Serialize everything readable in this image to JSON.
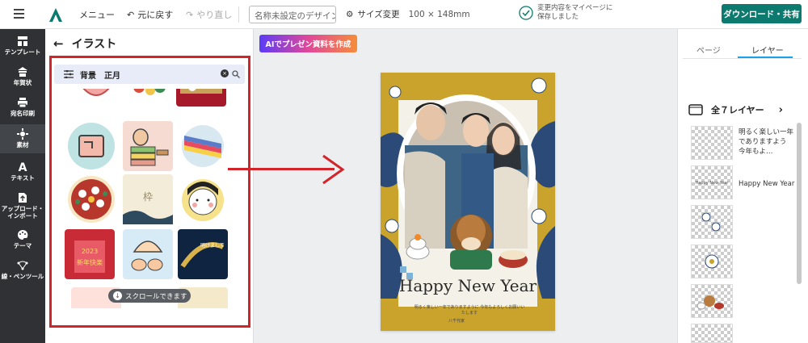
{
  "topbar": {
    "menu_label": "メニュー",
    "undo_label": "元に戻す",
    "redo_label": "やり直し",
    "design_name_placeholder": "名称未設定のデザイン",
    "resize_label": "サイズ変更",
    "size_value": "100 × 148mm",
    "saved_status": "変更内容をマイページに保存しました",
    "download_label": "ダウンロード・共有",
    "brand_color": "#0c7a6e"
  },
  "leftnav": {
    "items": [
      {
        "label": "テンプレート",
        "icon": "template-icon"
      },
      {
        "label": "年賀状",
        "icon": "newyear-card-icon"
      },
      {
        "label": "宛名印刷",
        "icon": "printer-icon"
      },
      {
        "label": "素材",
        "icon": "material-icon",
        "active": true
      },
      {
        "label": "テキスト",
        "icon": "text-icon"
      },
      {
        "label": "アップロード・インポート",
        "icon": "upload-icon"
      },
      {
        "label": "テーマ",
        "icon": "palette-icon"
      },
      {
        "label": "線・ペンツール",
        "icon": "pen-tool-icon"
      }
    ]
  },
  "panel": {
    "title": "イラスト",
    "search_value": "背景　正月",
    "scroll_hint": "スクロールできます",
    "highlight_color": "#d3242a"
  },
  "canvas": {
    "ai_button": "AIでプレゼン資料を作成",
    "card": {
      "greeting": "Happy New Year",
      "message": "明るく楽しい一年でありますように 今年もよろしくお願いいたします",
      "name": "八千代家"
    }
  },
  "rightpanel": {
    "tabs": [
      "ページ",
      "レイヤー"
    ],
    "active_tab": "レイヤー",
    "layer_count_label": "全７レイヤー",
    "layers": [
      {
        "label": "明るく楽しい一年でありますよう 今年もよ…"
      },
      {
        "label": "Happy New Year"
      },
      {
        "label": ""
      },
      {
        "label": ""
      },
      {
        "label": ""
      },
      {
        "label": ""
      }
    ],
    "accent_color": "#1aa1e8"
  }
}
